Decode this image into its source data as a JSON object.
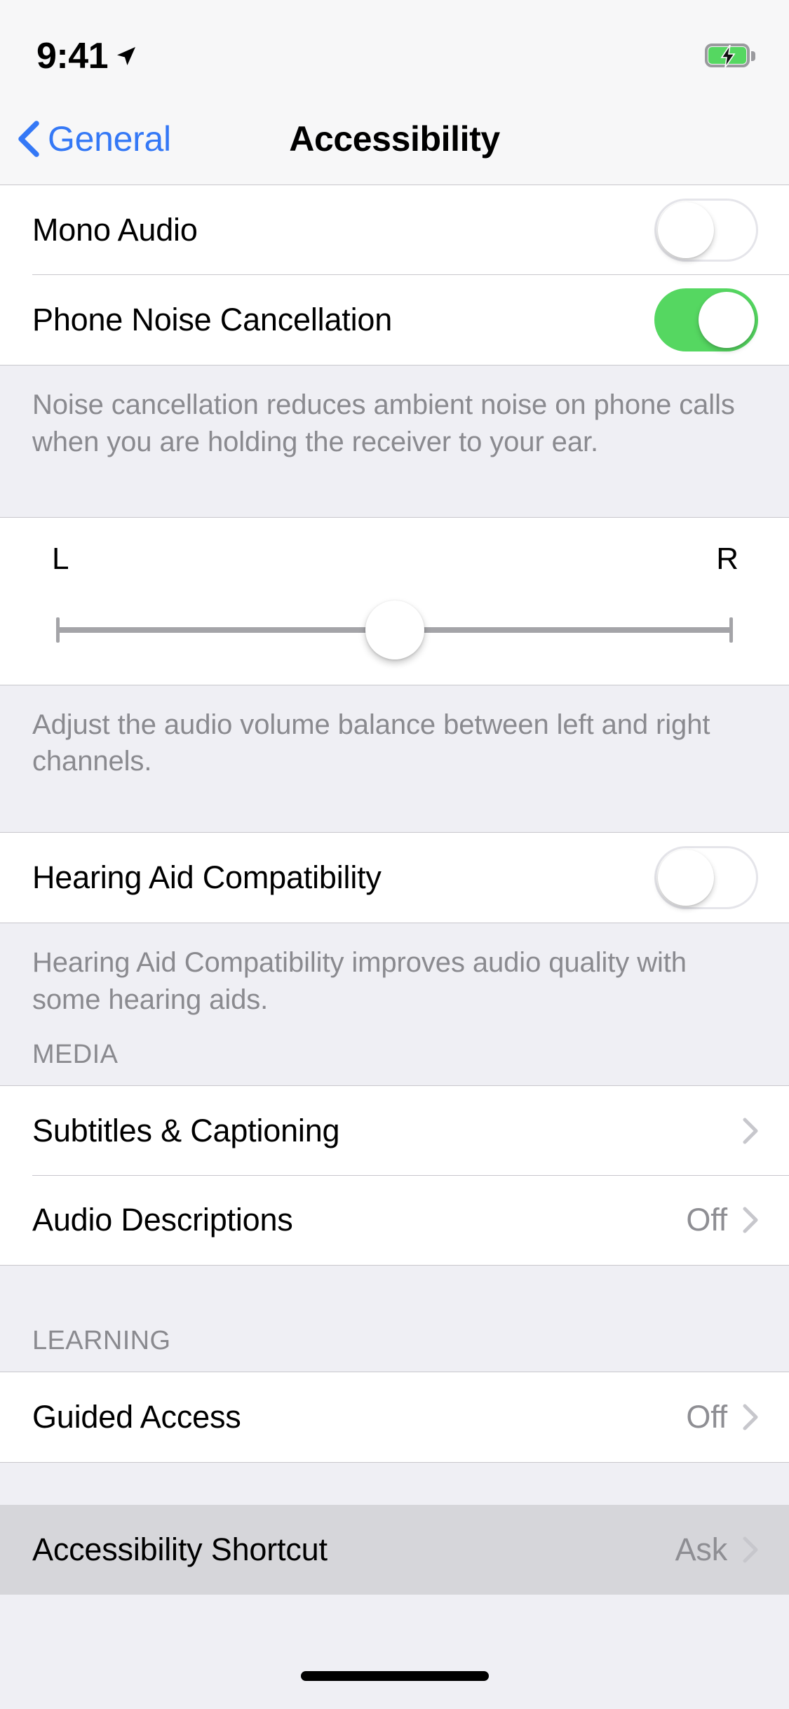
{
  "status_bar": {
    "time": "9:41",
    "location_icon": "location-arrow-icon",
    "battery_icon": "battery-charging-icon",
    "battery_state": "charging",
    "battery_color": "#55D761"
  },
  "nav": {
    "back_label": "General",
    "back_icon": "chevron-left-icon",
    "title": "Accessibility",
    "accent_color": "#3478F6"
  },
  "sections": {
    "hearing": {
      "rows": [
        {
          "label": "Mono Audio",
          "control": "toggle",
          "value": "off"
        },
        {
          "label": "Phone Noise Cancellation",
          "control": "toggle",
          "value": "on"
        }
      ],
      "footer": "Noise cancellation reduces ambient noise on phone calls when you are holding the receiver to your ear."
    },
    "balance": {
      "left_label": "L",
      "right_label": "R",
      "slider_value": 50,
      "footer": "Adjust the audio volume balance between left and right channels."
    },
    "hearing_aid": {
      "rows": [
        {
          "label": "Hearing Aid Compatibility",
          "control": "toggle",
          "value": "off"
        }
      ],
      "footer": "Hearing Aid Compatibility improves audio quality with some hearing aids."
    },
    "media": {
      "header": "MEDIA",
      "rows": [
        {
          "label": "Subtitles & Captioning",
          "value": "",
          "disclosure": "chevron-right-icon"
        },
        {
          "label": "Audio Descriptions",
          "value": "Off",
          "disclosure": "chevron-right-icon"
        }
      ]
    },
    "learning": {
      "header": "LEARNING",
      "rows": [
        {
          "label": "Guided Access",
          "value": "Off",
          "disclosure": "chevron-right-icon"
        }
      ]
    },
    "shortcut": {
      "rows": [
        {
          "label": "Accessibility Shortcut",
          "value": "Ask",
          "disclosure": "chevron-right-icon",
          "highlighted": true
        }
      ]
    }
  },
  "home_indicator": "home-indicator-bar"
}
